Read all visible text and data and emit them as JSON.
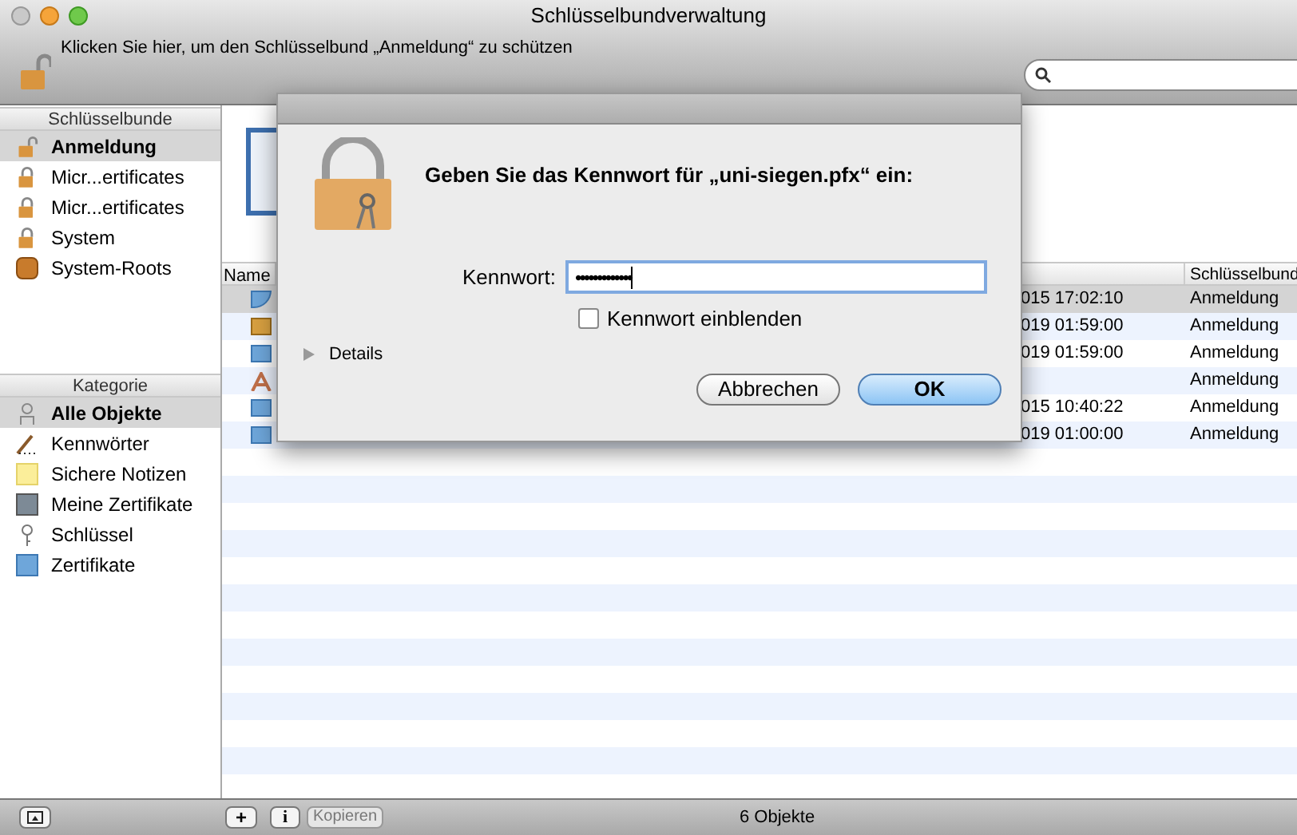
{
  "window": {
    "title": "Schlüsselbundverwaltung"
  },
  "toolbar": {
    "lock_message": "Klicken Sie hier, um den Schlüsselbund „Anmeldung“ zu schützen"
  },
  "sidebar": {
    "keychains_header": "Schlüsselbunde",
    "keychains": [
      {
        "label": "Anmeldung",
        "kind": "unlocked",
        "selected": true
      },
      {
        "label": "Micr...ertificates",
        "kind": "locked",
        "selected": false
      },
      {
        "label": "Micr...ertificates",
        "kind": "locked",
        "selected": false
      },
      {
        "label": "System",
        "kind": "locked",
        "selected": false
      },
      {
        "label": "System-Roots",
        "kind": "roots",
        "selected": false
      }
    ],
    "categories_header": "Kategorie",
    "categories": [
      {
        "label": "Alle Objekte",
        "selected": true
      },
      {
        "label": "Kennwörter",
        "selected": false
      },
      {
        "label": "Sichere Notizen",
        "selected": false
      },
      {
        "label": "Meine Zertifikate",
        "selected": false
      },
      {
        "label": "Schlüssel",
        "selected": false
      },
      {
        "label": "Zertifikate",
        "selected": false
      }
    ]
  },
  "table": {
    "columns": [
      "Name",
      "Schlüsselbund"
    ],
    "rows": [
      {
        "kind": "identity",
        "date": "015 17:02:10",
        "keychain": "Anmeldung",
        "selected": true
      },
      {
        "kind": "root",
        "date": "019 01:59:00",
        "keychain": "Anmeldung",
        "selected": false
      },
      {
        "kind": "certificate",
        "date": "019 01:59:00",
        "keychain": "Anmeldung",
        "selected": false
      },
      {
        "kind": "application",
        "keychain": "Anmeldung",
        "selected": false
      },
      {
        "kind": "certificate",
        "date": "015 10:40:22",
        "keychain": "Anmeldung",
        "selected": false
      },
      {
        "kind": "certificate",
        "date": "019 01:00:00",
        "keychain": "Anmeldung",
        "selected": false
      }
    ]
  },
  "dialog": {
    "title": "Geben Sie das Kennwort für „uni-siegen.pfx“ ein:",
    "password_label": "Kennwort:",
    "password_value": "•••••••••••••",
    "show_password": {
      "label": "Kennwort einblenden",
      "checked": false
    },
    "details": {
      "label": "Details",
      "expanded": false
    },
    "buttons": [
      {
        "label": "Abbrechen",
        "default": false
      },
      {
        "label": "OK",
        "default": true
      }
    ]
  },
  "status_bar": {
    "add": "+",
    "info": "i",
    "copy": {
      "label": "Kopieren",
      "disabled": true
    },
    "count": "6 Objekte"
  }
}
